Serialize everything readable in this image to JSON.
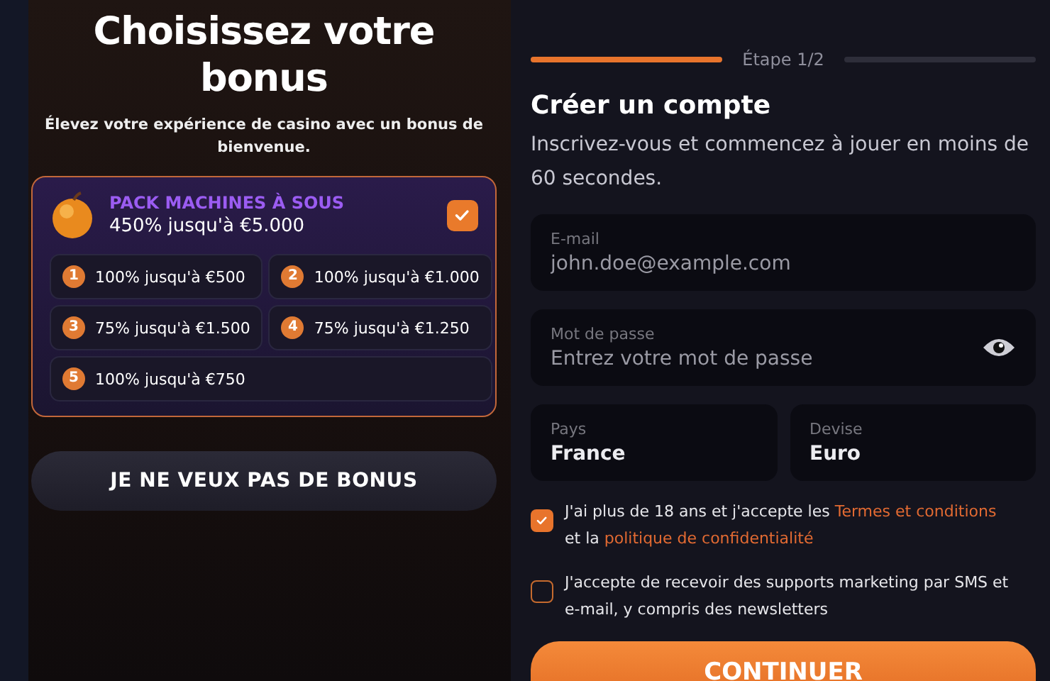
{
  "bonus_panel": {
    "title": "Choisissez votre bonus",
    "subtitle": "Élevez votre expérience de casino avec un bonus de bienvenue.",
    "pack": {
      "name": "PACK MACHINES À SOUS",
      "amount": "450% jusqu'à €5.000",
      "selected": true,
      "offers": [
        {
          "number": "1",
          "text": "100% jusqu'à €500"
        },
        {
          "number": "2",
          "text": "100% jusqu'à €1.000"
        },
        {
          "number": "3",
          "text": "75% jusqu'à €1.500"
        },
        {
          "number": "4",
          "text": "75% jusqu'à €1.250"
        },
        {
          "number": "5",
          "text": "100% jusqu'à €750"
        }
      ]
    },
    "no_bonus_button": "JE NE VEUX PAS DE BONUS"
  },
  "signup": {
    "step": {
      "label": "Étape 1/2"
    },
    "title": "Créer un compte",
    "subtitle": "Inscrivez-vous et commencez à jouer en moins de 60 secondes.",
    "fields": [
      {
        "label": "E-mail",
        "placeholder": "john.doe@example.com",
        "kind": "text"
      },
      {
        "label": "Mot de passe",
        "placeholder": "Entrez votre mot de passe",
        "kind": "password"
      }
    ],
    "selects": [
      {
        "label": "Pays",
        "value": "France"
      },
      {
        "label": "Devise",
        "value": "Euro"
      }
    ],
    "consents": [
      {
        "checked": true,
        "parts": [
          {
            "text": "J'ai plus de 18 ans et j'accepte les "
          },
          {
            "text": "Termes et conditions",
            "link": true
          },
          {
            "text": " et la "
          },
          {
            "text": "politique de confidentialité",
            "link": true
          }
        ]
      },
      {
        "checked": false,
        "parts": [
          {
            "text": "J'accepte de recevoir des supports marketing par SMS et e-mail, y compris des newsletters"
          }
        ]
      }
    ],
    "continue_button": "CONTINUER"
  }
}
